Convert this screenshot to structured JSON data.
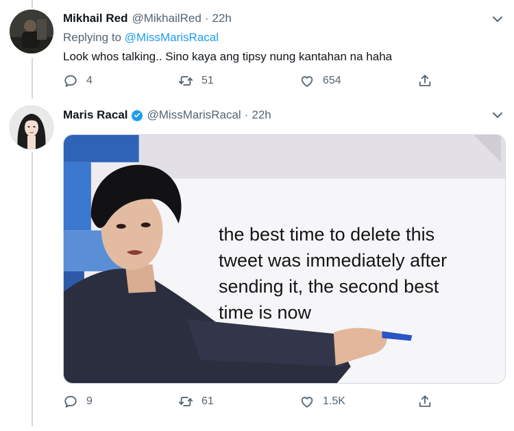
{
  "tweets": [
    {
      "display_name": "Mikhail Red",
      "handle": "@MikhailRed",
      "separator": "·",
      "time": "22h",
      "replying_prefix": "Replying to",
      "replying_to": "@MissMarisRacal",
      "text": "Look whos talking.. Sino kaya ang tipsy nung kantahan na haha",
      "replies": "4",
      "retweets": "51",
      "likes": "654"
    },
    {
      "display_name": "Maris Racal",
      "verified": true,
      "handle": "@MissMarisRacal",
      "separator": "·",
      "time": "22h",
      "image_caption": {
        "line1": "the best time to delete this",
        "line2": "tweet was immediately after",
        "line3": "sending it, the second best",
        "line4": "time is now"
      },
      "replies": "9",
      "retweets": "61",
      "likes": "1.5K"
    }
  ],
  "colors": {
    "text": "#0f1419",
    "secondary": "#536471",
    "accent": "#1d9bf0",
    "divider": "#cfd9de"
  },
  "icons": [
    "reply-icon",
    "retweet-icon",
    "like-icon",
    "share-icon",
    "chevron-down-icon",
    "verified-badge-icon"
  ]
}
